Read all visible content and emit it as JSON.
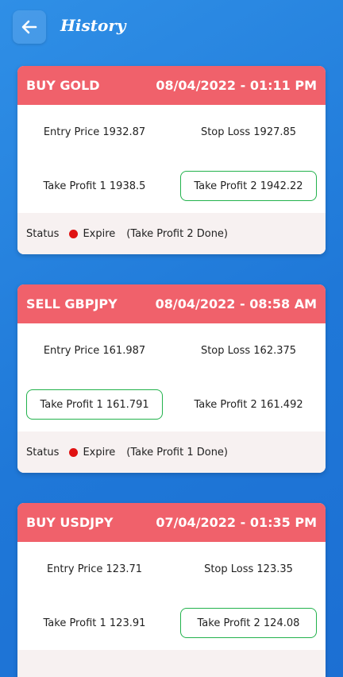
{
  "header": {
    "title": "History",
    "back_icon": "arrow-left-icon"
  },
  "trades": [
    {
      "title": "BUY GOLD",
      "datetime": "08/04/2022 - 01:11 PM",
      "entry": "Entry Price 1932.87",
      "stop": "Stop Loss 1927.85",
      "tp1": "Take Profit 1 1938.5",
      "tp2": "Take Profit 2 1942.22",
      "hit": "tp2",
      "status_label": "Status",
      "status": "Expire",
      "status_note": "(Take Profit 2 Done)"
    },
    {
      "title": "SELL GBPJPY",
      "datetime": "08/04/2022 - 08:58 AM",
      "entry": "Entry Price 161.987",
      "stop": "Stop Loss 162.375",
      "tp1": "Take Profit 1 161.791",
      "tp2": "Take Profit 2 161.492",
      "hit": "tp1",
      "status_label": "Status",
      "status": "Expire",
      "status_note": "(Take Profit 1 Done)"
    },
    {
      "title": "BUY USDJPY",
      "datetime": "07/04/2022 - 01:35 PM",
      "entry": "Entry Price 123.71",
      "stop": "Stop Loss 123.35",
      "tp1": "Take Profit 1 123.91",
      "tp2": "Take Profit 2 124.08",
      "hit": "tp2"
    }
  ],
  "colors": {
    "header": "#f0616b",
    "hit_border": "#22b24c",
    "status_dot": "#e01212",
    "background": "#1f78d8"
  }
}
